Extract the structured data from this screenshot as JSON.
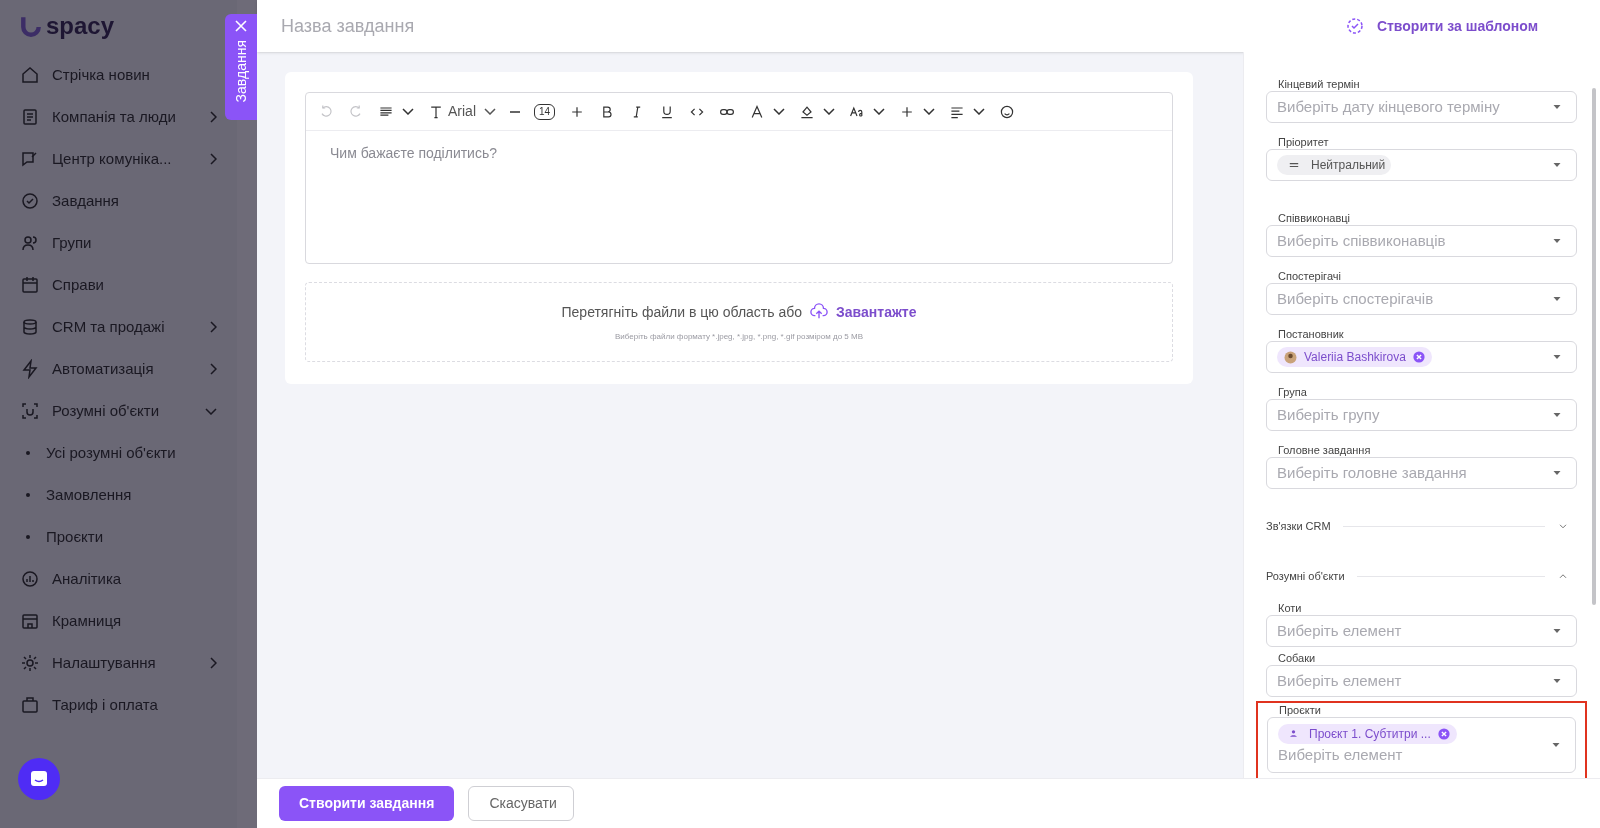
{
  "sidebar": {
    "logo": "spacy",
    "items": [
      {
        "label": "Стрічка новин",
        "kind": "link"
      },
      {
        "label": "Компанія та люди",
        "kind": "group",
        "expanded": false
      },
      {
        "label": "Центр комуніка...",
        "kind": "group",
        "expanded": false
      },
      {
        "label": "Завдання",
        "kind": "link"
      },
      {
        "label": "Групи",
        "kind": "link"
      },
      {
        "label": "Справи",
        "kind": "link"
      },
      {
        "label": "CRM та продажі",
        "kind": "group",
        "expanded": false
      },
      {
        "label": "Автоматизація",
        "kind": "group",
        "expanded": false
      },
      {
        "label": "Розумні об'єкти",
        "kind": "group",
        "expanded": true,
        "children": [
          {
            "label": "Усі розумні об'єкти"
          },
          {
            "label": "Замовлення"
          },
          {
            "label": "Проєкти"
          }
        ]
      },
      {
        "label": "Аналітика",
        "kind": "link"
      },
      {
        "label": "Крамниця",
        "kind": "link"
      },
      {
        "label": "Налаштування",
        "kind": "group",
        "expanded": false
      },
      {
        "label": "Тариф і оплата",
        "kind": "link"
      }
    ]
  },
  "panel_tab": {
    "label": "Завдання"
  },
  "header": {
    "title_placeholder": "Назва завдання",
    "template_link": "Створити за шаблоном"
  },
  "editor": {
    "font": "Arial",
    "font_size": "14",
    "placeholder": "Чим бажаєте поділитись?"
  },
  "upload": {
    "text": "Перетягніть файли в цю область або",
    "link": "Завантажте",
    "hint": "Виберіть файли формату *.jpeg, *.jpg, *.png, *.gif розміром до 5 MB"
  },
  "fields": [
    {
      "kind": "select",
      "label": "Кінцевий термін",
      "placeholder": "Виберіть дату кінцевого терміну"
    },
    {
      "kind": "priority",
      "label": "Пріоритет",
      "chip": "Нейтральний"
    },
    {
      "kind": "gap"
    },
    {
      "kind": "select",
      "label": "Співвиконавці",
      "placeholder": "Виберіть співвиконавців"
    },
    {
      "kind": "select",
      "label": "Спостерігачі",
      "placeholder": "Виберіть спостерігачів"
    },
    {
      "kind": "person",
      "label": "Постановник",
      "chip": "Valeriia Bashkirova"
    },
    {
      "kind": "select",
      "label": "Група",
      "placeholder": "Виберіть групу"
    },
    {
      "kind": "select",
      "label": "Головне завдання",
      "placeholder": "Виберіть головне завдання"
    },
    {
      "kind": "section",
      "label": "Зв'язки CRM",
      "expanded": false
    },
    {
      "kind": "section",
      "label": "Розумні об'єкти",
      "expanded": true
    },
    {
      "kind": "select",
      "label": "Коти",
      "placeholder": "Виберіть елемент"
    },
    {
      "kind": "select",
      "label": "Собаки",
      "placeholder": "Виберіть елемент"
    },
    {
      "kind": "multi",
      "label": "Проєкти",
      "chip": "Проєкт 1. Субтитри ...",
      "placeholder": "Виберіть елемент",
      "highlighted": true
    }
  ],
  "buttons": {
    "primary": "Створити завдання",
    "secondary": "Скасувати"
  }
}
